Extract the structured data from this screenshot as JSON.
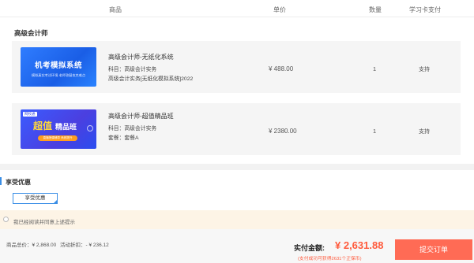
{
  "table_header": {
    "product": "商品",
    "price": "单价",
    "quantity": "数量",
    "card_pay": "学习卡支付"
  },
  "section": {
    "title": "高级会计师"
  },
  "items": [
    {
      "thumb_title": "机考模拟系统",
      "thumb_sub": "模拟真实考试环境 老师答疑攻克难点",
      "name": "高级会计师-无纸化系统",
      "line1": "科目：高级会计实务",
      "line2": "高级会计实务[无纸化模拟系统]2022",
      "price": "¥ 488.00",
      "quantity": "1",
      "card_support": "支持"
    },
    {
      "thumb_tag": "网校通",
      "thumb_big": "超值",
      "thumb_small": "精品班",
      "thumb_btn": "直播授课辅导 系统提升",
      "name": "高级会计师-超值精品班",
      "line1": "科目：高级会计实务",
      "line2": "套餐：套餐A",
      "price": "¥ 2380.00",
      "quantity": "1",
      "card_support": "支持"
    }
  ],
  "promo": {
    "title": "享受优惠",
    "button": "享受优惠"
  },
  "agreement": {
    "text": "我已经阅读并同意上述提示"
  },
  "footer": {
    "total": "商品总价：¥ 2,868.00",
    "discount": "活动折扣：- ¥ 236.12",
    "paid_label": "实付金额:",
    "paid_amount": "¥ 2,631.88",
    "points": "(支付成功可获得2631个正保币)",
    "submit": "提交订单"
  },
  "colors": {
    "accent": "#ff5a3c",
    "submit_bg": "#ff6b55",
    "link_blue": "#3a8ee6"
  }
}
